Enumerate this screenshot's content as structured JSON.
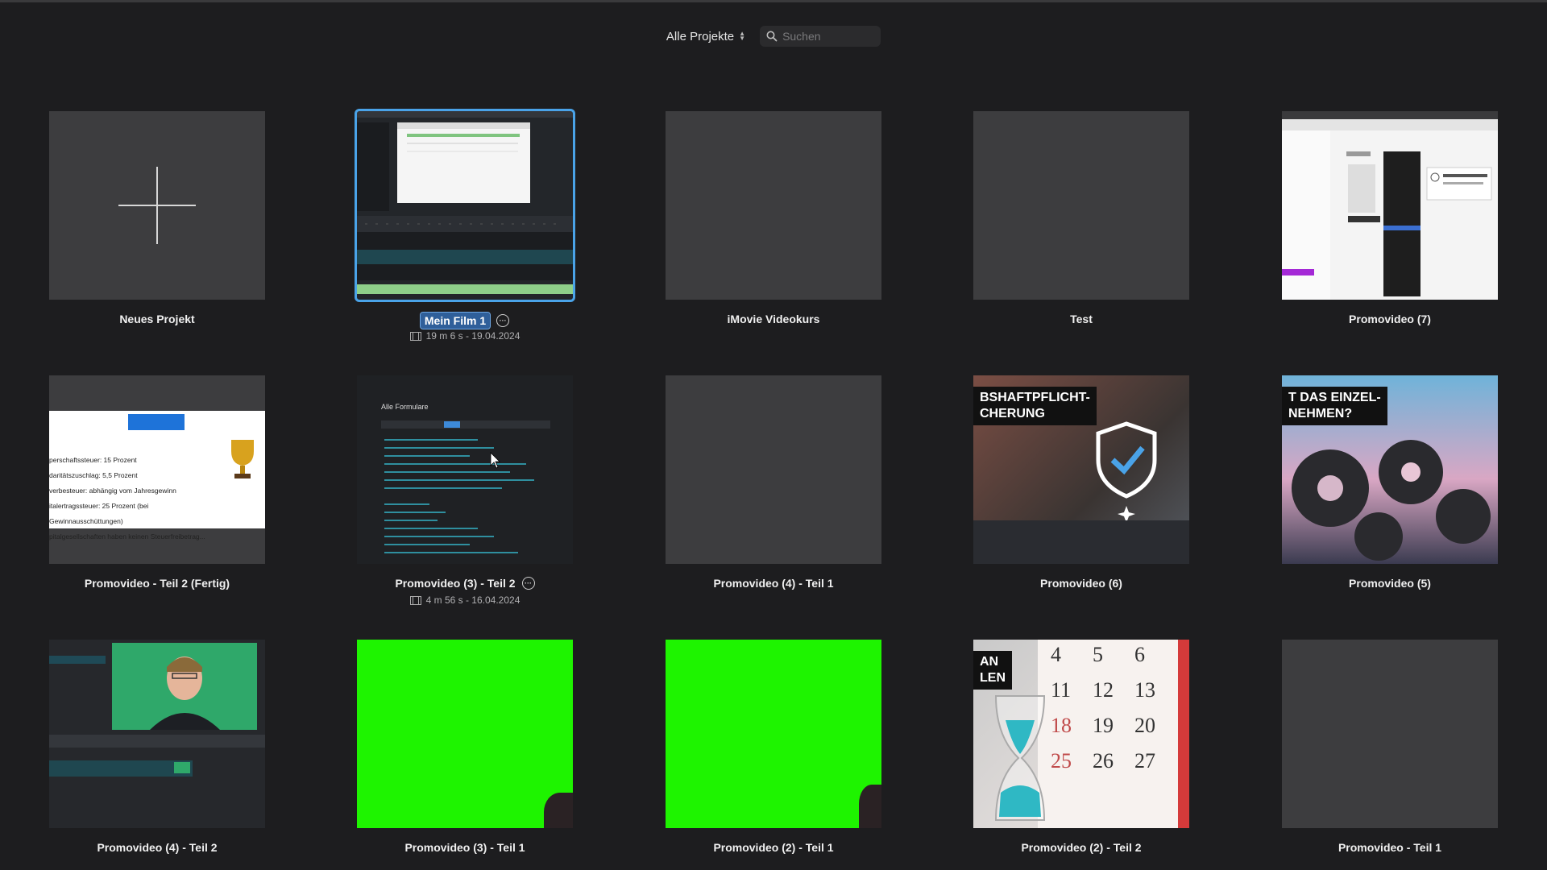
{
  "toolbar": {
    "filter_label": "Alle Projekte",
    "search_placeholder": "Suchen"
  },
  "projects": [
    {
      "title": "Neues Projekt"
    },
    {
      "title": "Mein Film 1",
      "meta": "19 m 6 s - 19.04.2024"
    },
    {
      "title": "iMovie Videokurs"
    },
    {
      "title": "Test"
    },
    {
      "title": "Promovideo (7)"
    },
    {
      "title": "Promovideo - Teil 2 (Fertig)",
      "thumb_lines": [
        "perschaftssteuer: 15 Prozent",
        "daritätszuschlag: 5,5 Prozent",
        "verbesteuer: abhängig vom Jahresgewinn",
        "italertragssteuer: 25 Prozent (bei Gewinnausschüttungen)",
        "pitalgesellschaften haben keinen Steuerfreibetrag..."
      ]
    },
    {
      "title": "Promovideo (3) - Teil 2",
      "meta": "4 m 56 s - 16.04.2024",
      "thumb_heading": "Alle Formulare"
    },
    {
      "title": "Promovideo (4) - Teil 1"
    },
    {
      "title": "Promovideo (6)",
      "thumb_caption": "BSHAFTPFLICHT-\nCHERUNG"
    },
    {
      "title": "Promovideo (5)",
      "thumb_caption": "T DAS EINZEL-\nNEHMEN?"
    },
    {
      "title": "Promovideo (4) - Teil 2"
    },
    {
      "title": "Promovideo (3) - Teil 1"
    },
    {
      "title": "Promovideo (2) - Teil 1"
    },
    {
      "title": "Promovideo (2) - Teil 2",
      "thumb_caption": "AN\nLEN",
      "calendar": [
        "4",
        "5",
        "6",
        "11",
        "12",
        "13",
        "18",
        "19",
        "20",
        "25",
        "26",
        "27"
      ]
    },
    {
      "title": "Promovideo - Teil 1"
    }
  ],
  "colors": {
    "background": "#1d1d1f",
    "selection": "#4aa3e8",
    "chroma_green": "#1ef400"
  }
}
